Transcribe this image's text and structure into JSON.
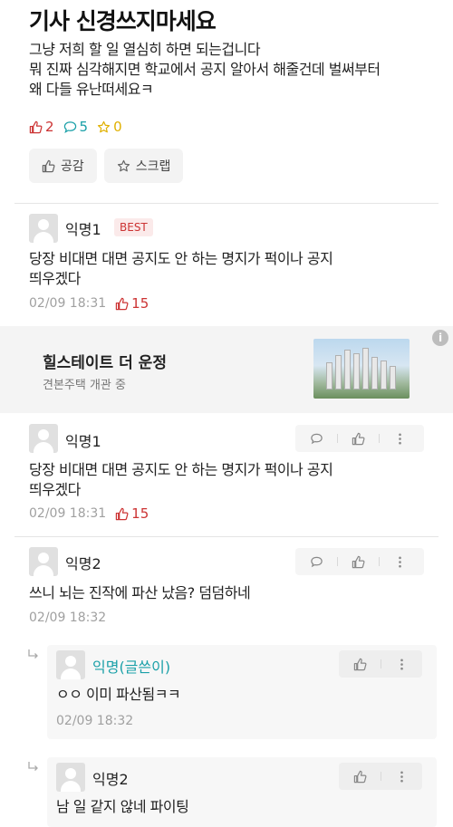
{
  "post": {
    "title": "기사 신경쓰지마세요",
    "body": "그냥 저희 할 일 열심히 하면 되는겁니다\n뭐 진짜 심각해지면 학교에서 공지 알아서 해줄건데 벌써부터\n왜 다들 유난떠세요ㅋ",
    "likes": "2",
    "comments": "5",
    "scraps": "0",
    "like_button": "공감",
    "scrap_button": "스크랩"
  },
  "best_comment": {
    "author": "익명1",
    "badge": "BEST",
    "text": "당장 비대면 대면 공지도 안 하는 명지가 퍽이나 공지\n띄우겠다",
    "time": "02/09 18:31",
    "votes": "15"
  },
  "ad": {
    "title": "힐스테이트 더 운정",
    "subtitle": "견본주택 개관 중",
    "info_label": "i"
  },
  "comments": [
    {
      "author": "익명1",
      "text": "당장 비대면 대면 공지도 안 하는 명지가 퍽이나 공지\n띄우겠다",
      "time": "02/09 18:31",
      "votes": "15"
    },
    {
      "author": "익명2",
      "text": "쓰니 뇌는 진작에 파산 났음?  덤덤하네",
      "time": "02/09 18:32"
    }
  ],
  "replies": [
    {
      "author": "익명(글쓴이)",
      "text": "ㅇㅇ 이미 파산됨ㅋㅋ",
      "time": "02/09 18:32"
    },
    {
      "author": "익명2",
      "text": "남 일 같지 않네 파이팅"
    }
  ],
  "colors": {
    "like": "#cc3333",
    "comment": "#1aa0a8",
    "scrap": "#e0b000",
    "author": "#1aa0a8"
  }
}
